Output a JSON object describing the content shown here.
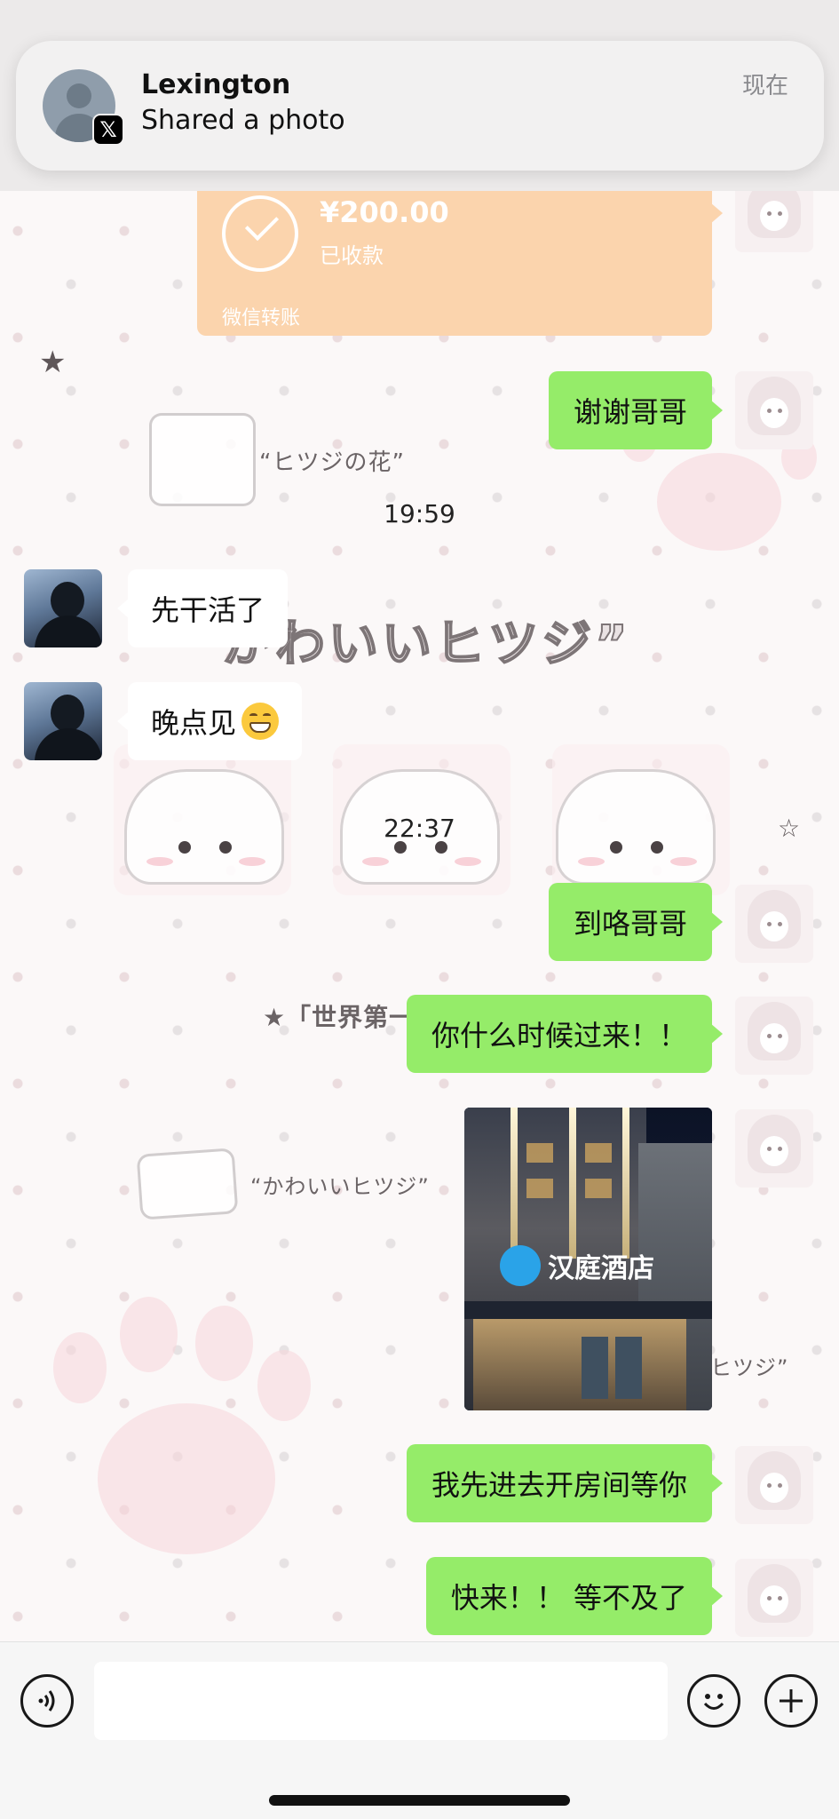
{
  "notification": {
    "title": "Lexington",
    "body": "Shared a photo",
    "time": "现在",
    "badge": "𝕏"
  },
  "transfer": {
    "amount": "¥200.00",
    "status": "已收款",
    "footer": "微信转账"
  },
  "wallpaper": {
    "caption_1": "“ヒツジの花”",
    "caption_2": "かわいいヒツジ”",
    "caption_3": "★「世界第一",
    "caption_4": "“かわいいヒツジ”",
    "caption_5": "ヒツジ”"
  },
  "messages": [
    {
      "side": "right",
      "text": "谢谢哥哥"
    },
    {
      "side": "left",
      "text": "先干活了"
    },
    {
      "side": "left",
      "text": "晚点见",
      "emoji": "grin-emoji"
    },
    {
      "side": "right",
      "text": "到咯哥哥"
    },
    {
      "side": "right",
      "text": "你什么时候过来！！"
    },
    {
      "side": "right",
      "type": "photo",
      "sign": "汉庭酒店"
    },
    {
      "side": "right",
      "text": "我先进去开房间等你"
    },
    {
      "side": "right",
      "text": "快来！！ 等不及了"
    }
  ],
  "timestamps": [
    "19:59",
    "22:37"
  ],
  "input_bar": {
    "voice_icon": "voice-icon",
    "input_value": "",
    "emoji_icon": "emoji-icon",
    "plus_icon": "plus-icon"
  },
  "colors": {
    "bubble_green": "#95ec69",
    "transfer_orange": "#fbd4ad"
  }
}
